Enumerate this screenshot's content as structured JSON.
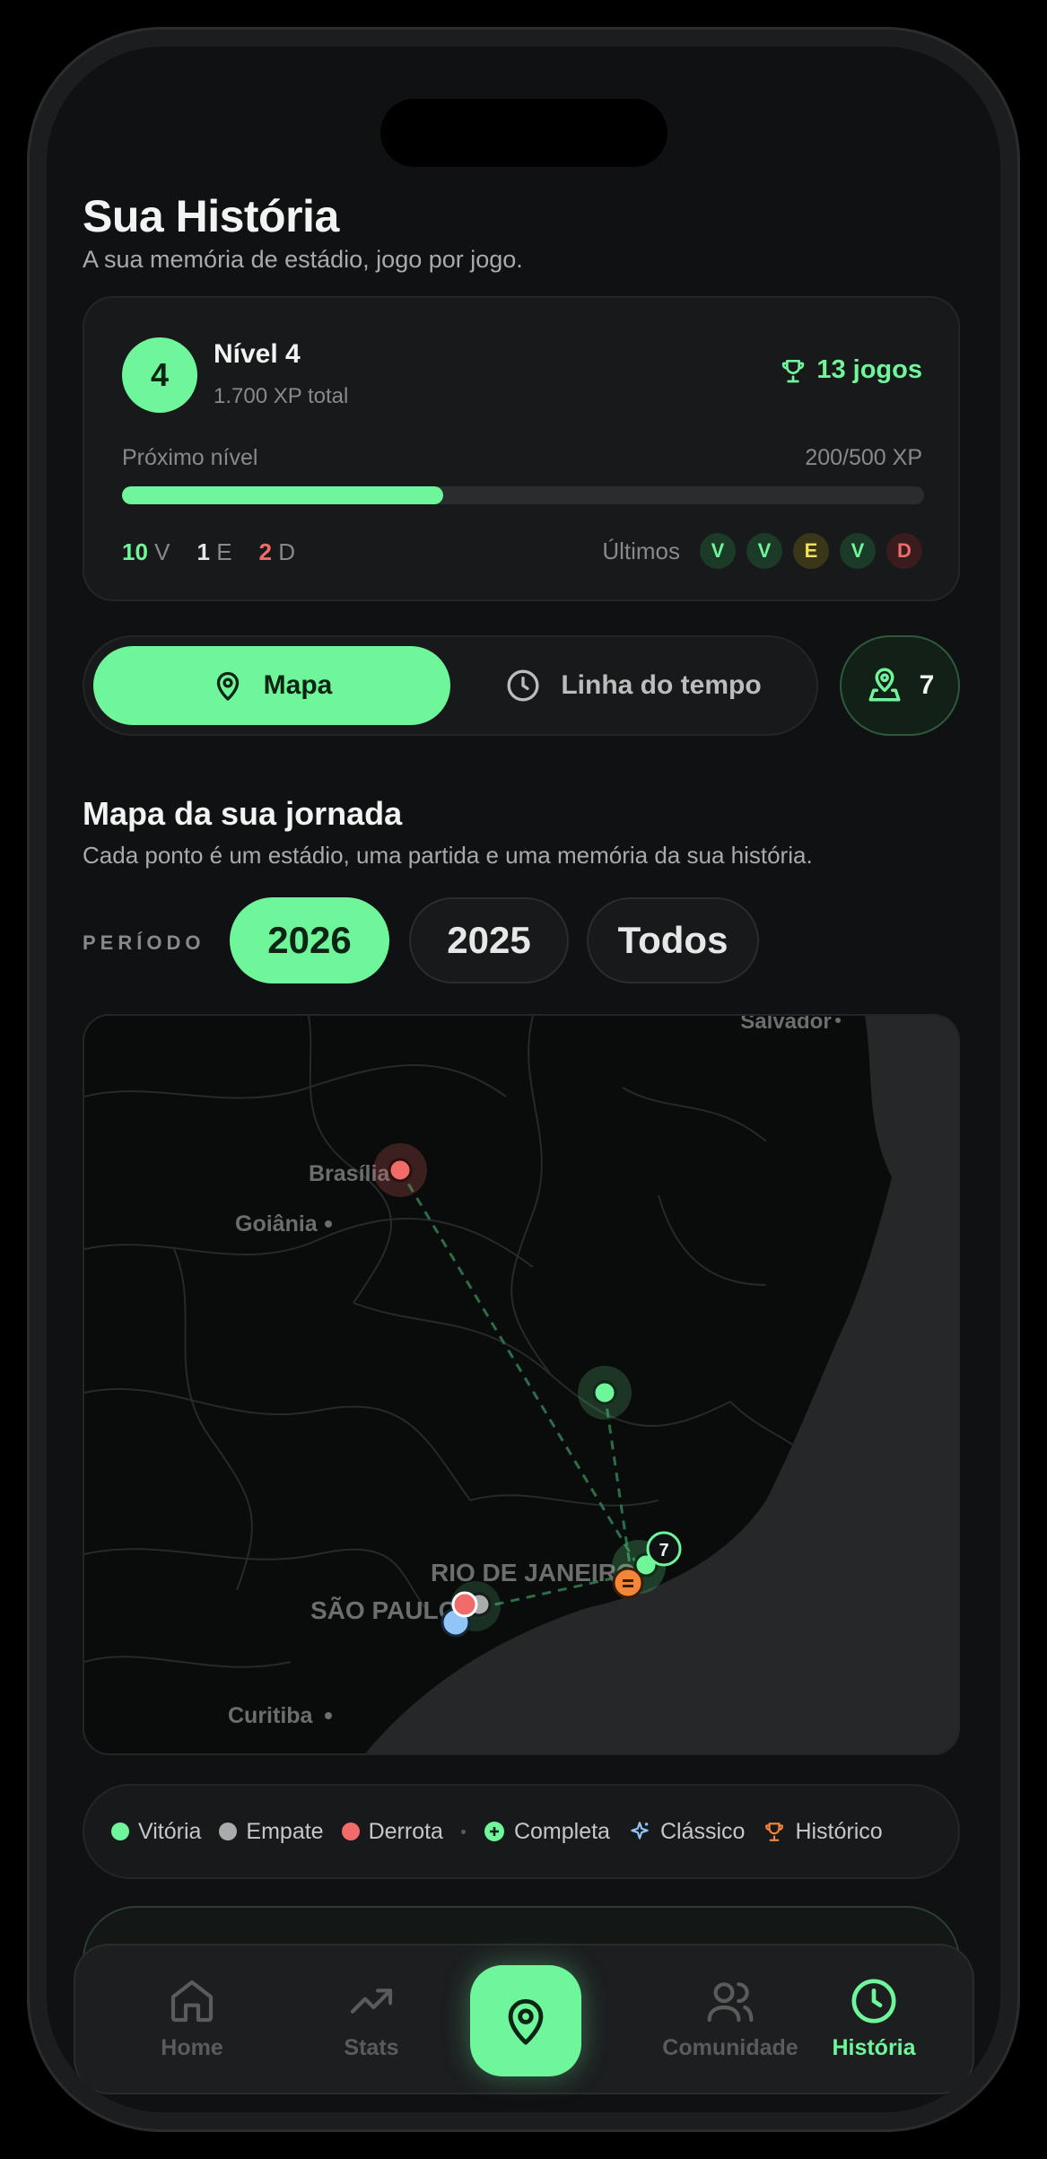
{
  "header": {
    "title": "Sua História",
    "subtitle": "A sua memória de estádio, jogo por jogo."
  },
  "level_card": {
    "level_number": "4",
    "level_title": "Nível 4",
    "xp_total": "1.700 XP total",
    "games": "13 jogos",
    "next_level_label": "Próximo nível",
    "next_level_value": "200/500 XP",
    "progress": 0.4,
    "record": {
      "wins": "10",
      "wins_label": "V",
      "draws": "1",
      "draws_label": "E",
      "losses": "2",
      "losses_label": "D"
    },
    "last_label": "Últimos",
    "last_results": [
      "V",
      "V",
      "E",
      "V",
      "D"
    ]
  },
  "view_toggle": {
    "map_label": "Mapa",
    "timeline_label": "Linha do tempo",
    "stadiums_count": "7"
  },
  "map_section": {
    "title": "Mapa da sua jornada",
    "subtitle": "Cada ponto é um estádio, uma partida e uma memória da sua história."
  },
  "period": {
    "label": "PERÍODO",
    "options": [
      "2026",
      "2025",
      "Todos"
    ],
    "selected": "2026"
  },
  "map": {
    "cities": {
      "salvador": "Salvador",
      "brasilia": "Brasília",
      "goiania": "Goiânia",
      "rio": "RIO DE JANEIRO",
      "sao_paulo": "SÃO PAULO",
      "curitiba": "Curitiba"
    },
    "cluster_count": "7"
  },
  "legend": {
    "win": "Vitória",
    "draw": "Empate",
    "loss": "Derrota",
    "complete": "Completa",
    "classic": "Clássico",
    "historic": "Histórico"
  },
  "nav": {
    "home": "Home",
    "stats": "Stats",
    "community": "Comunidade",
    "history": "História"
  },
  "colors": {
    "accent": "#6ff59a",
    "win": "#6ff59a",
    "draw": "#a8adac",
    "loss": "#f26b6b",
    "classic": "#8fc6f5",
    "historic": "#f2873a"
  }
}
